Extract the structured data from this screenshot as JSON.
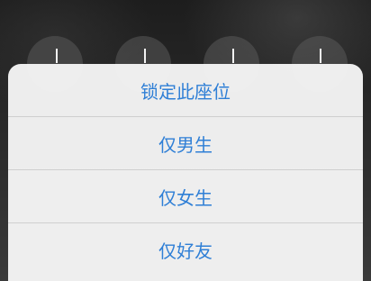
{
  "action_sheet": {
    "accent_color": "#2f7fd6",
    "items": [
      {
        "label": "锁定此座位"
      },
      {
        "label": "仅男生"
      },
      {
        "label": "仅女生"
      },
      {
        "label": "仅好友"
      }
    ]
  }
}
